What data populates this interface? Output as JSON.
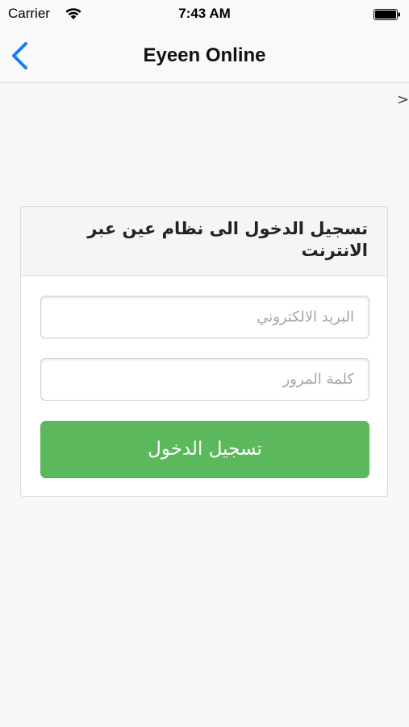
{
  "status_bar": {
    "carrier": "Carrier",
    "time": "7:43 AM"
  },
  "nav": {
    "title": "Eyeen Online",
    "back_icon": "chevron-left-icon",
    "accent_color": "#1a7cf5"
  },
  "content": {
    "chevron_right": ">"
  },
  "login_card": {
    "title": "تسجيل الدخول الى نظام عين عبر الانترنت",
    "email_placeholder": "البريد الالكتروني",
    "email_value": "",
    "password_placeholder": "كلمة المرور",
    "password_value": "",
    "submit_label": "تسجيل الدخول",
    "submit_color": "#5cb85c"
  }
}
